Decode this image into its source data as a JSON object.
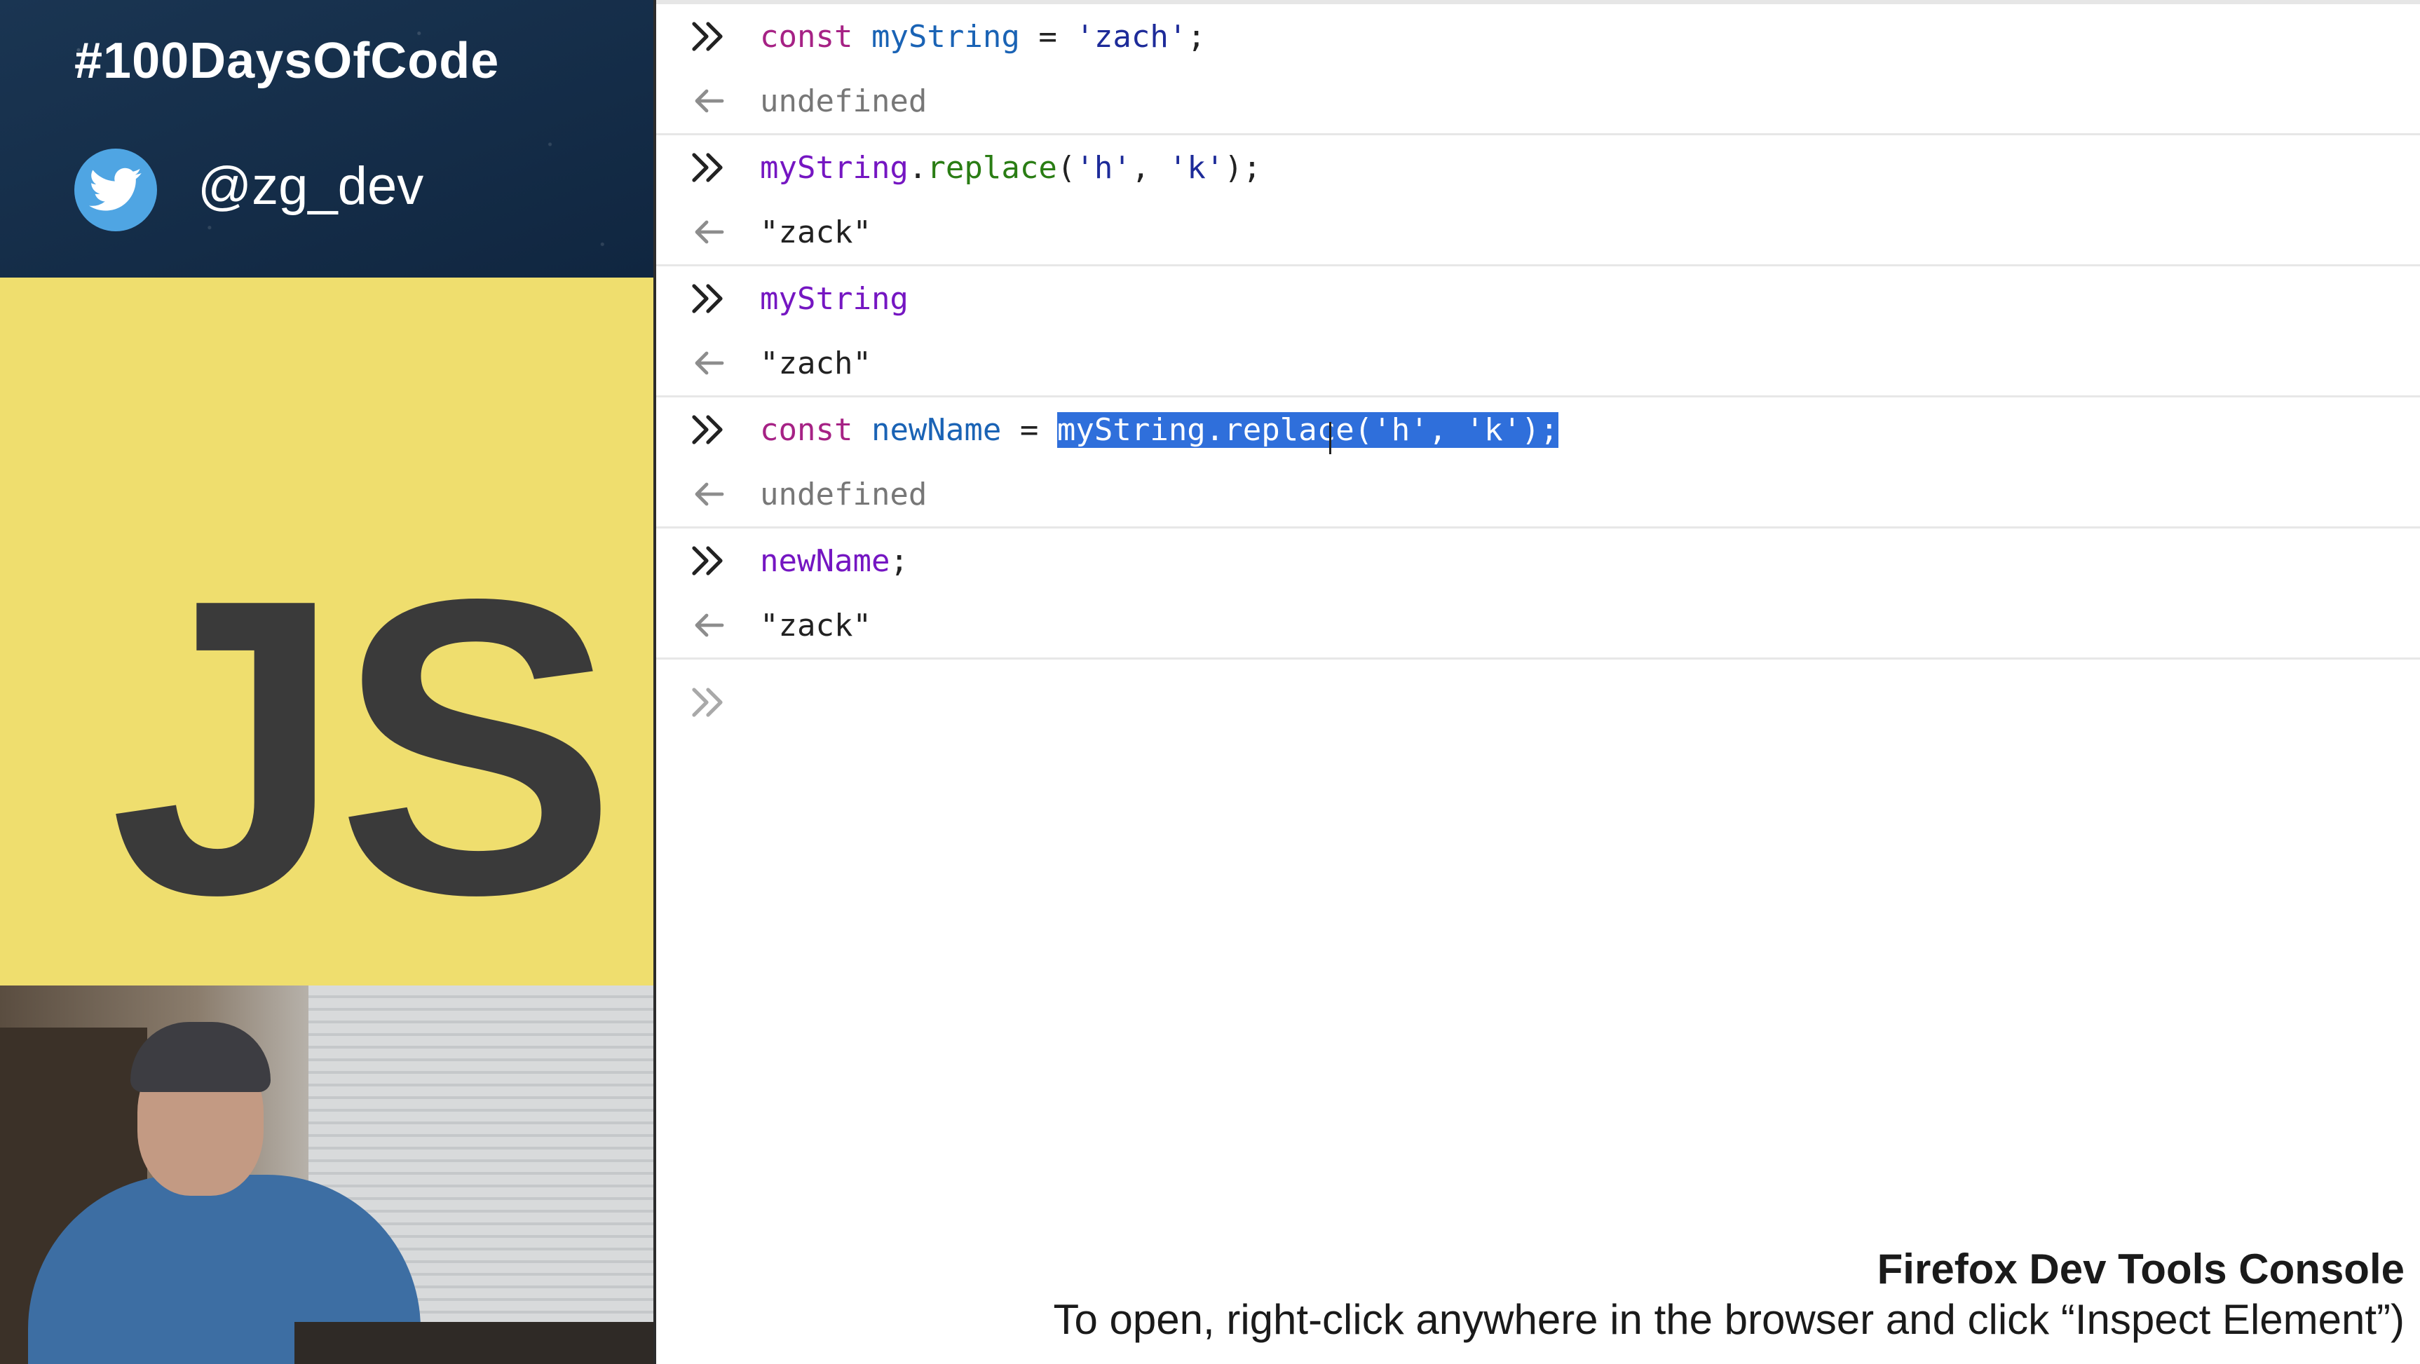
{
  "banner": {
    "hashtag": "#100DaysOfCode",
    "handle": "@zg_dev",
    "icon": "twitter-bird-icon",
    "colors": {
      "background": "#142c48",
      "icon_bg": "#4fa5e3"
    }
  },
  "js_panel": {
    "logo": "JS",
    "colors": {
      "background": "#efde6e",
      "logo": "#3a3a3a"
    }
  },
  "console": {
    "input_icon": "double-chevron-right-icon",
    "output_icon": "arrow-left-icon",
    "entries": [
      {
        "input": [
          {
            "t": "const",
            "c": "kw"
          },
          {
            "t": " ",
            "c": "op"
          },
          {
            "t": "myString",
            "c": "var"
          },
          {
            "t": " = ",
            "c": "op"
          },
          {
            "t": "'zach'",
            "c": "str"
          },
          {
            "t": ";",
            "c": "op"
          }
        ],
        "output": "undefined",
        "output_kind": "undef"
      },
      {
        "input": [
          {
            "t": "myString",
            "c": "id"
          },
          {
            "t": ".",
            "c": "op"
          },
          {
            "t": "replace",
            "c": "fn"
          },
          {
            "t": "(",
            "c": "op"
          },
          {
            "t": "'h'",
            "c": "str"
          },
          {
            "t": ", ",
            "c": "op"
          },
          {
            "t": "'k'",
            "c": "str"
          },
          {
            "t": ");",
            "c": "op"
          }
        ],
        "output": "\"zack\"",
        "output_kind": "out"
      },
      {
        "input": [
          {
            "t": "myString",
            "c": "id"
          }
        ],
        "output": "\"zach\"",
        "output_kind": "out"
      },
      {
        "input": [
          {
            "t": "const",
            "c": "kw"
          },
          {
            "t": " ",
            "c": "op"
          },
          {
            "t": "newName",
            "c": "var"
          },
          {
            "t": " = ",
            "c": "op"
          },
          {
            "t": "myString.replace('h', 'k');",
            "c": "sel"
          }
        ],
        "output": "undefined",
        "output_kind": "undef"
      },
      {
        "input": [
          {
            "t": "newName",
            "c": "id"
          },
          {
            "t": ";",
            "c": "op"
          }
        ],
        "output": "\"zack\"",
        "output_kind": "out"
      }
    ],
    "colors": {
      "keyword": "#a62285",
      "variable": "#1a63b5",
      "string": "#1d2b99",
      "function": "#2a7d14",
      "identifier": "#7516c2",
      "selection": "#2f6fdb"
    }
  },
  "caption": {
    "title": "Firefox Dev Tools Console",
    "text": "To open, right-click anywhere in the browser and click “Inspect Element”)"
  }
}
